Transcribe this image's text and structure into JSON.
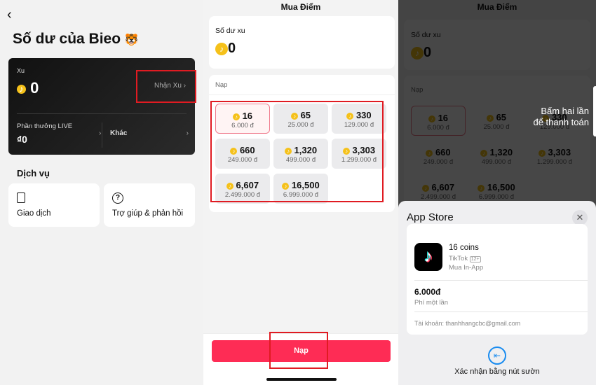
{
  "balance_screen": {
    "title": "Số dư của Bieo",
    "emoji": "🐯",
    "coins_label": "Xu",
    "coins_value": "0",
    "get_coins": "Nhận Xu",
    "get_coins_chevron": "›",
    "live_rewards_label": "Phần thưởng LIVE",
    "live_rewards_value": "₫0",
    "other_label": "Khác",
    "chevron": "›",
    "services_title": "Dịch vụ",
    "services": [
      {
        "label": "Giao dịch",
        "icon": "receipt-icon"
      },
      {
        "label": "Trợ giúp & phản hồi",
        "icon": "help-icon"
      }
    ]
  },
  "purchase_screen": {
    "title": "Mua Điểm",
    "balance_label": "Số dư xu",
    "balance_value": "0",
    "topup_label": "Nạp",
    "packages": [
      {
        "coins": "16",
        "price": "6.000 đ",
        "selected": true
      },
      {
        "coins": "65",
        "price": "25.000 đ"
      },
      {
        "coins": "330",
        "price": "129.000 đ"
      },
      {
        "coins": "660",
        "price": "249.000 đ"
      },
      {
        "coins": "1,320",
        "price": "499.000 đ"
      },
      {
        "coins": "3,303",
        "price": "1.299.000 đ"
      },
      {
        "coins": "6,607",
        "price": "2.499.000 đ"
      },
      {
        "coins": "16,500",
        "price": "6.999.000 đ"
      }
    ],
    "button": "Nạp",
    "accent": "#fe2c55"
  },
  "payment_sheet": {
    "side_hint_line1": "Bấm hai lần",
    "side_hint_line2": "để thanh toán",
    "title": "App Store",
    "item": "16 coins",
    "app": "TikTok",
    "age": "12+",
    "type": "Mua In-App",
    "price": "6.000đ",
    "price_note": "Phí một lần",
    "account": "Tài khoản: thanhhangcbc@gmail.com",
    "confirm": "Xác nhận bằng nút sườn"
  },
  "highlight_color": "#e01b22"
}
